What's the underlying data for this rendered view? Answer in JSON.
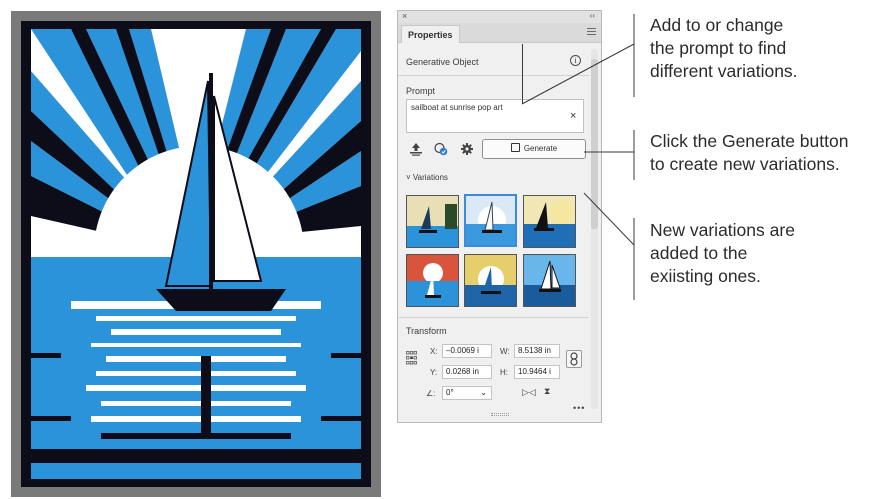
{
  "panel": {
    "tab_label": "Properties",
    "close_glyph": "×",
    "collapse_glyph": "‹‹",
    "section_title": "Generative Object",
    "info_glyph": "i",
    "prompt_label": "Prompt",
    "prompt_value": "sailboat at sunrise pop art",
    "clear_glyph": "×",
    "generate_label": "Generate",
    "variations_label": "Variations",
    "variations_toggle": "˅",
    "transform_label": "Transform",
    "x_label": "X:",
    "x_value": "–0.0069 i",
    "y_label": "Y:",
    "y_value": "0.0268 in",
    "w_label": "W:",
    "w_value": "8.5138 in",
    "h_label": "H:",
    "h_value": "10.9464 i",
    "angle_label": "∠:",
    "angle_value": "0°",
    "more_glyph": "•••",
    "tool_icons": [
      "upload-icon",
      "variation-check-icon",
      "settings-gear-icon"
    ],
    "variation_count": 6,
    "selected_variation_index": 1
  },
  "callouts": [
    {
      "lines": [
        "Add to or change",
        "the prompt to find",
        "different variations."
      ]
    },
    {
      "lines": [
        "Click the Generate button",
        "to create new variations."
      ]
    },
    {
      "lines": [
        "New variations are",
        "added to the",
        "exiisting ones."
      ]
    }
  ],
  "colors": {
    "artwork_blue": "#2b93d9",
    "artwork_dark": "#0d0d1a",
    "selection_blue": "#3a8bd8",
    "panel_bg": "#f0f0f0"
  }
}
